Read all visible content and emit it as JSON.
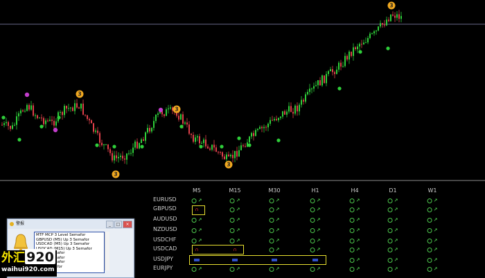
{
  "chart": {
    "type": "candlestick",
    "up_color": "#2fcf3a",
    "down_color": "#e0404a",
    "level_line_color": "#6a6a8a",
    "signals": [
      {
        "label": "3",
        "color": "#f0a820"
      },
      {
        "label": "3",
        "color": "#f0a820"
      },
      {
        "label": "3",
        "color": "#f0a820"
      },
      {
        "label": "3",
        "color": "#f0a820"
      },
      {
        "label": "3",
        "color": "#f0a820"
      }
    ]
  },
  "panel": {
    "timeframes": [
      "M5",
      "M15",
      "M30",
      "H1",
      "H4",
      "D1",
      "W1"
    ],
    "pairs": [
      {
        "name": "EURUSD",
        "signals": [
          "up",
          "up",
          "up",
          "up",
          "up",
          "up",
          "up"
        ]
      },
      {
        "name": "GBPUSD",
        "signals": [
          "down",
          "up",
          "up",
          "up",
          "up",
          "up",
          "up"
        ]
      },
      {
        "name": "AUDUSD",
        "signals": [
          "up",
          "up",
          "up",
          "up",
          "up",
          "up",
          "up"
        ]
      },
      {
        "name": "NZDUSD",
        "signals": [
          "up",
          "up",
          "up",
          "up",
          "up",
          "up",
          "up"
        ]
      },
      {
        "name": "USDCHF",
        "signals": [
          "up",
          "up",
          "up",
          "up",
          "up",
          "up",
          "up"
        ]
      },
      {
        "name": "USDCAD",
        "signals": [
          "down",
          "down",
          "up",
          "up",
          "up",
          "up",
          "up"
        ]
      },
      {
        "name": "USDJPY",
        "signals": [
          "blue",
          "blue",
          "blue",
          "blue",
          "up",
          "up",
          "up"
        ]
      },
      {
        "name": "EURJPY",
        "signals": [
          "up",
          "up",
          "up",
          "up",
          "up",
          "up",
          "up"
        ]
      }
    ],
    "up_color": "#4ec94e",
    "down_color": "#e03030",
    "highlight_color": "#e8e030"
  },
  "alert": {
    "title": "警报",
    "messages": [
      "MTF MCP 3 Level Semafor",
      "GBPUSD (M5) Up 3 Semafor",
      "USDCAD (M5) Up 3 Semafor",
      "USDCAD (M15) Up 3 Semafor",
      "own 3 Semafor",
      "own 3 Semafor",
      "own 3 Semafor",
      "wn 3 Semafor"
    ],
    "buttons": [
      "_",
      "□",
      "×"
    ]
  },
  "watermark": {
    "cn": "外汇",
    "number": "920",
    "url": "waihui920.com"
  }
}
